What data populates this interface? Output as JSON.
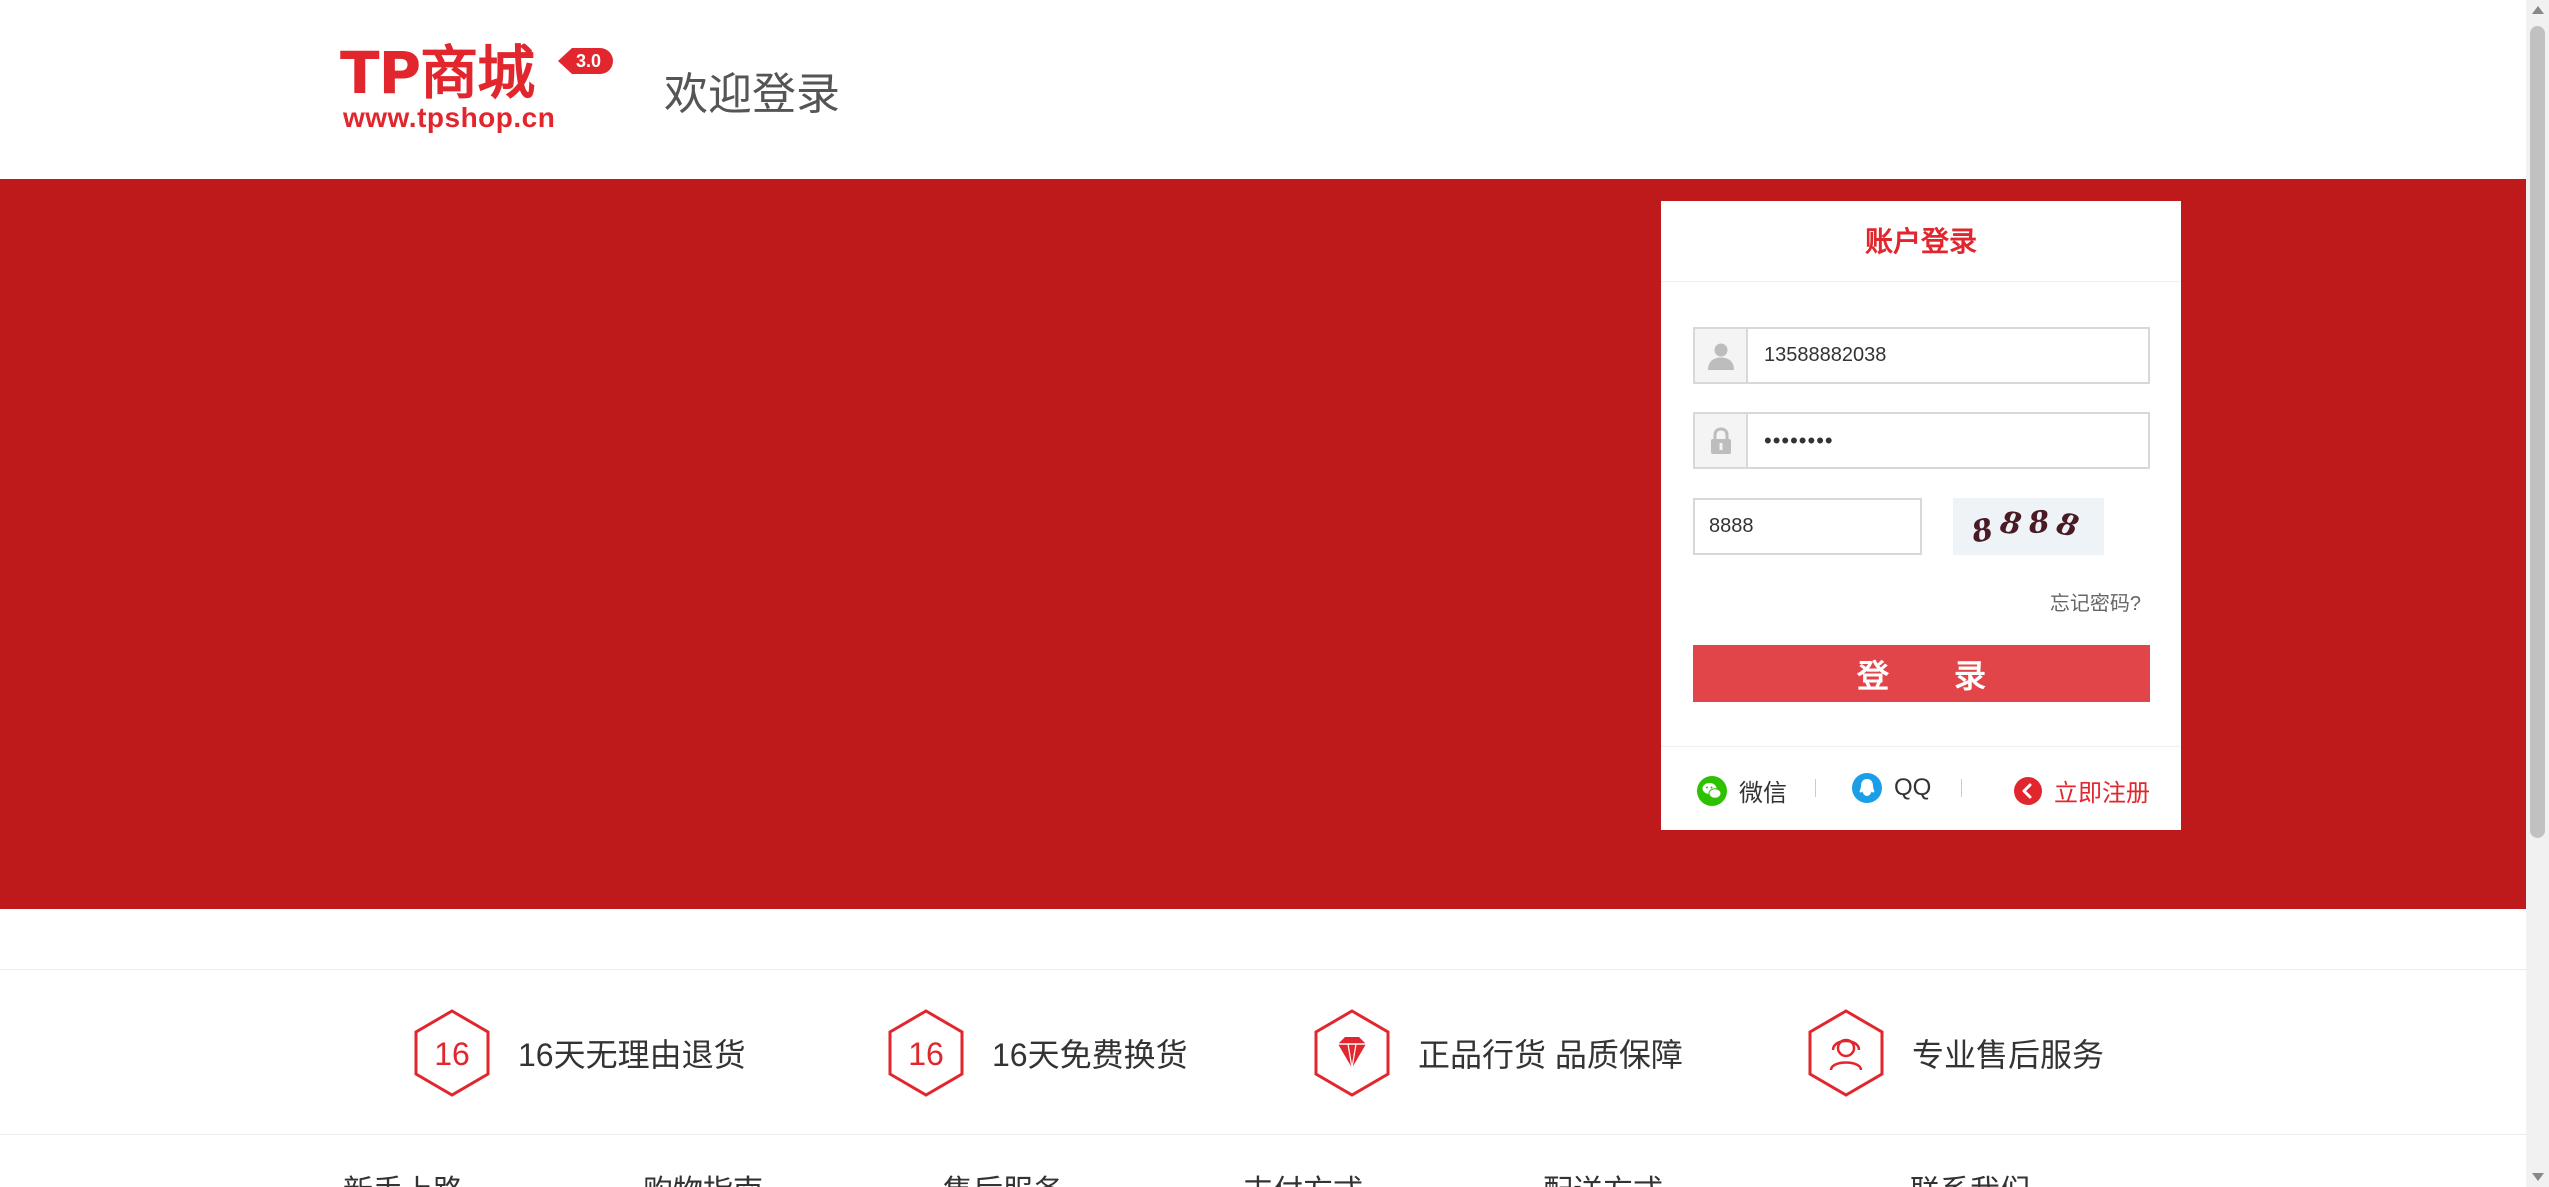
{
  "header": {
    "logo_text": "TP商城",
    "logo_version": "3.0",
    "logo_url": "www.tpshop.cn",
    "welcome": "欢迎登录"
  },
  "login": {
    "title": "账户登录",
    "username_value": "13588882038",
    "username_icon": "user-icon",
    "password_value": "••••••••",
    "password_icon": "lock-icon",
    "captcha_value": "8888",
    "captcha_image_text": [
      "8",
      "8",
      "8",
      "8"
    ],
    "forgot_link": "忘记密码?",
    "submit": "登 录",
    "wechat": "微信",
    "qq": "QQ",
    "register": "立即注册"
  },
  "services": [
    {
      "icon": "hexagon-16-icon",
      "badge": "16",
      "label": "16天无理由退货"
    },
    {
      "icon": "hexagon-16-icon",
      "badge": "16",
      "label": "16天免费换货"
    },
    {
      "icon": "diamond-icon",
      "label": "正品行货 品质保障"
    },
    {
      "icon": "customer-service-icon",
      "label": "专业售后服务"
    }
  ],
  "footer_columns": [
    "新手上路",
    "购物指南",
    "售后服务",
    "支付方式",
    "配送方式",
    "联系我们"
  ],
  "colors": {
    "brand_red": "#e1262d",
    "banner_red": "#be1a1b",
    "button_red": "#e1454a"
  }
}
